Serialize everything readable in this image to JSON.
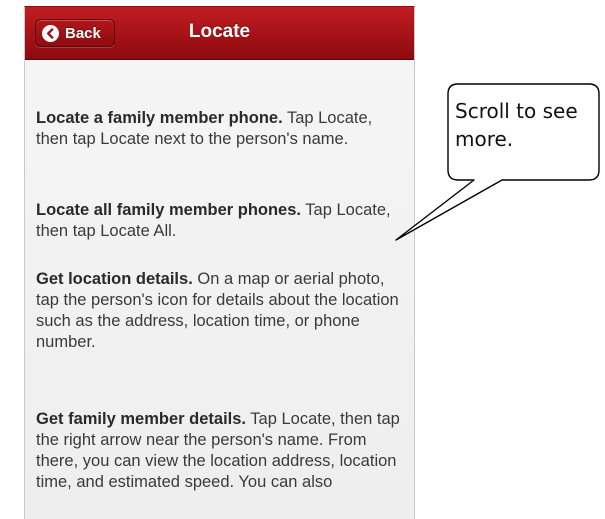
{
  "navbar": {
    "back_label": "Back",
    "title": "Locate"
  },
  "content": {
    "paragraphs": [
      {
        "heading": "Locate a family member phone.",
        "body": " Tap Locate, then tap Locate next to the person's name."
      },
      {
        "heading": "Locate all family member phones.",
        "body": " Tap Locate, then tap Locate All."
      },
      {
        "heading": "Get location details.",
        "body": " On a map or aerial photo, tap the person's icon for details about the location such as the address, location time, or phone number."
      },
      {
        "heading": "Get family member details.",
        "body": " Tap Locate, then tap the right arrow near the person's name. From there, you can view the location address, location time, and estimated speed. You can also"
      }
    ]
  },
  "callout": {
    "line1": "Scroll  to see",
    "line2": "more."
  },
  "colors": {
    "navbar_red": "#a51217",
    "text": "#3a3a3a"
  }
}
